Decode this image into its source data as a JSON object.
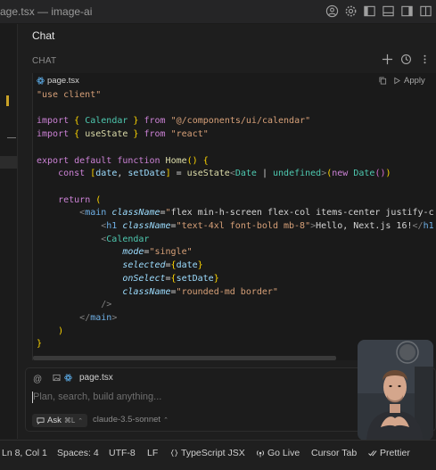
{
  "window": {
    "title": "age.tsx — image-ai"
  },
  "chat": {
    "tab_label": "Chat",
    "section_label": "CHAT"
  },
  "code_block": {
    "file_name": "page.tsx",
    "apply_label": "Apply",
    "lines": [
      "\"use client\"",
      "",
      "import { Calendar } from \"@/components/ui/calendar\"",
      "import { useState } from \"react\"",
      "",
      "export default function Home() {",
      "    const [date, setDate] = useState<Date | undefined>(new Date())",
      "",
      "    return (",
      "        <main className=\"flex min-h-screen flex-col items-center justify-c",
      "            <h1 className=\"text-4xl font-bold mb-8\">Hello, Next.js 16!</h1",
      "            <Calendar",
      "                mode=\"single\"",
      "                selected={date}",
      "                onSelect={setDate}",
      "                className=\"rounded-md border\"",
      "            />",
      "        </main>",
      "    )",
      "}"
    ]
  },
  "composer": {
    "context_at": "@",
    "context_file": "page.tsx",
    "placeholder": "Plan, search, build anything...",
    "mode_label": "Ask",
    "mode_shortcut": "⌘L",
    "model_label": "claude-3.5-sonnet"
  },
  "status_bar": {
    "cursor_pos": "Ln 8, Col 1",
    "spaces": "Spaces: 4",
    "encoding": "UTF-8",
    "eol": "LF",
    "language": "TypeScript JSX",
    "go_live": "Go Live",
    "cursor_tab": "Cursor Tab",
    "prettier": "Prettier"
  },
  "icons": {
    "title_bar": [
      "account-icon",
      "gear-icon",
      "toggle-primary-sidebar-icon",
      "toggle-panel-icon",
      "toggle-secondary-sidebar-icon",
      "customize-layout-icon"
    ],
    "chat_actions": [
      "plus-icon",
      "history-icon",
      "more-icon"
    ]
  },
  "colors": {
    "background": "#1e1e1e",
    "keyword": "#cc82d6",
    "string": "#d7a078",
    "function": "#dcdcaa",
    "type": "#4ec9b0",
    "variable": "#9cdcfe"
  }
}
